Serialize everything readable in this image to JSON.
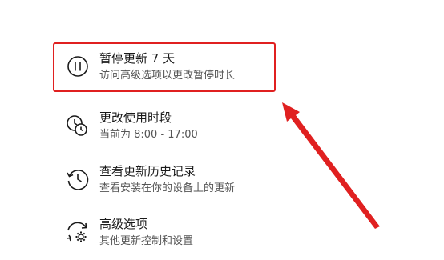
{
  "annotation": {
    "highlight_color": "#e02020",
    "arrow_color": "#e02020"
  },
  "items": [
    {
      "icon": "pause-icon",
      "title": "暂停更新 7 天",
      "description": "访问高级选项以更改暂停时长"
    },
    {
      "icon": "active-hours-clock-icon",
      "title": "更改使用时段",
      "description": "当前为 8:00 - 17:00"
    },
    {
      "icon": "history-clock-icon",
      "title": "查看更新历史记录",
      "description": "查看安装在你的设备上的更新"
    },
    {
      "icon": "advanced-options-gear-icon",
      "title": "高级选项",
      "description": "其他更新控制和设置"
    }
  ]
}
